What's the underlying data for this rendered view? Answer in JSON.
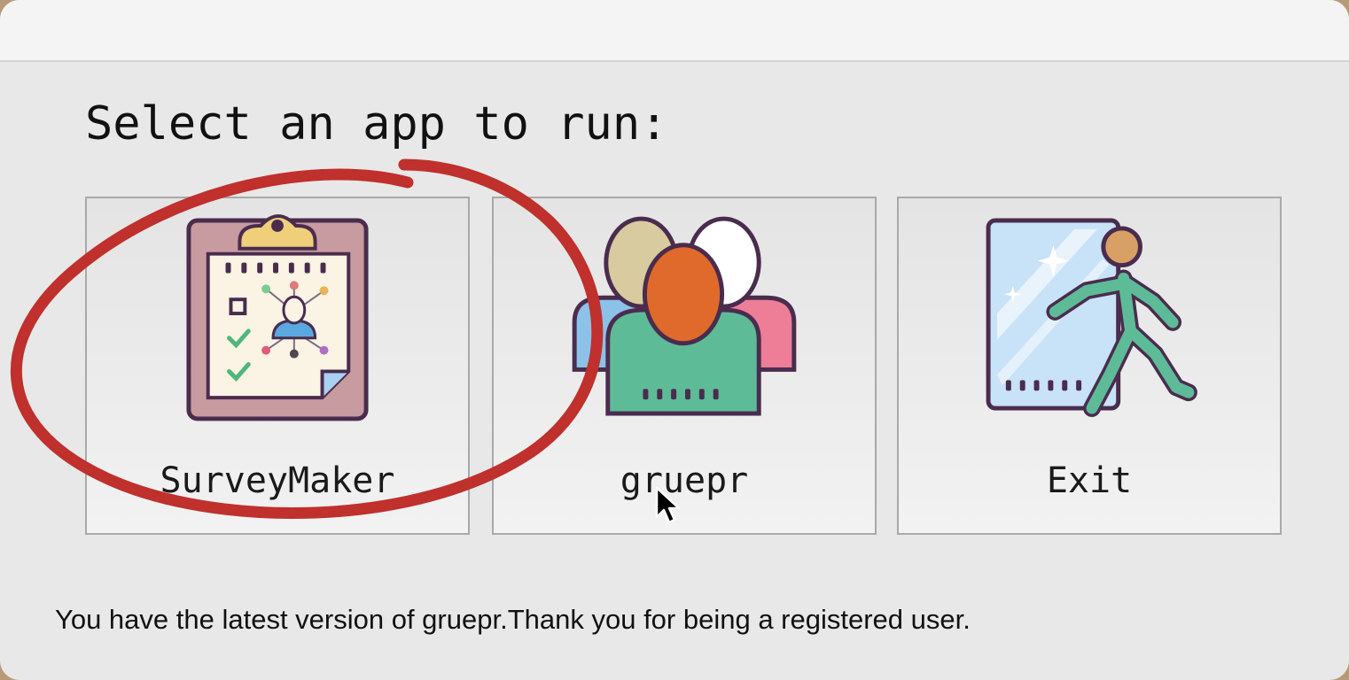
{
  "prompt": "Select an app to run:",
  "apps": [
    {
      "label": "SurveyMaker",
      "icon": "clipboard-survey-icon"
    },
    {
      "label": "gruepr",
      "icon": "people-group-icon"
    },
    {
      "label": "Exit",
      "icon": "exit-door-icon"
    }
  ],
  "status_message": "You have the latest version of gruepr.Thank you for being a registered user.",
  "colors": {
    "window_bg": "#e8e8e8",
    "annotation_red": "#c0302c",
    "icon_outline": "#4a2c4e"
  }
}
